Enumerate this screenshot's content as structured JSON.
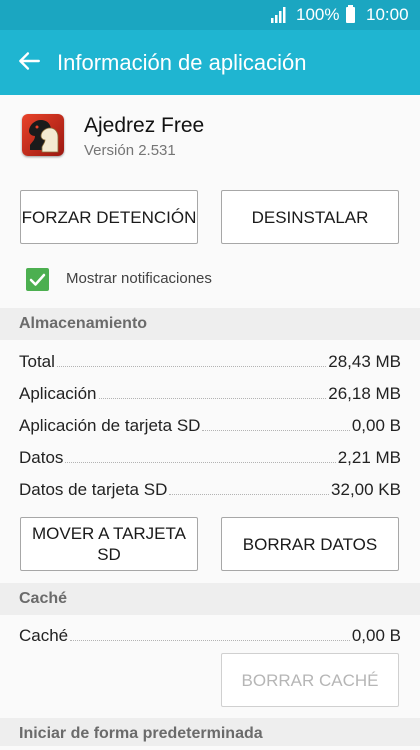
{
  "status_bar": {
    "battery": "100%",
    "time": "10:00"
  },
  "app_bar": {
    "title": "Información de aplicación"
  },
  "app": {
    "name": "Ajedrez Free",
    "version": "Versión 2.531"
  },
  "actions": {
    "force_stop": "FORZAR DETENCIÓN",
    "uninstall": "DESINSTALAR"
  },
  "notifications": {
    "label": "Mostrar notificaciones",
    "checked": true
  },
  "storage": {
    "header": "Almacenamiento",
    "rows": [
      {
        "label": "Total",
        "value": "28,43 MB"
      },
      {
        "label": "Aplicación",
        "value": "26,18 MB"
      },
      {
        "label": "Aplicación de tarjeta SD",
        "value": "0,00 B"
      },
      {
        "label": "Datos",
        "value": "2,21 MB"
      },
      {
        "label": "Datos de tarjeta SD",
        "value": "32,00 KB"
      }
    ],
    "move_button": "MOVER A TARJETA SD",
    "clear_data_button": "BORRAR DATOS"
  },
  "cache": {
    "header": "Caché",
    "row": {
      "label": "Caché",
      "value": "0,00 B"
    },
    "clear_button": "BORRAR CACHÉ"
  },
  "defaults": {
    "header": "Iniciar de forma predeterminada"
  },
  "colors": {
    "status_bar": "#1ba6c1",
    "app_bar": "#1fb5d1",
    "checkbox": "#4caf50"
  }
}
